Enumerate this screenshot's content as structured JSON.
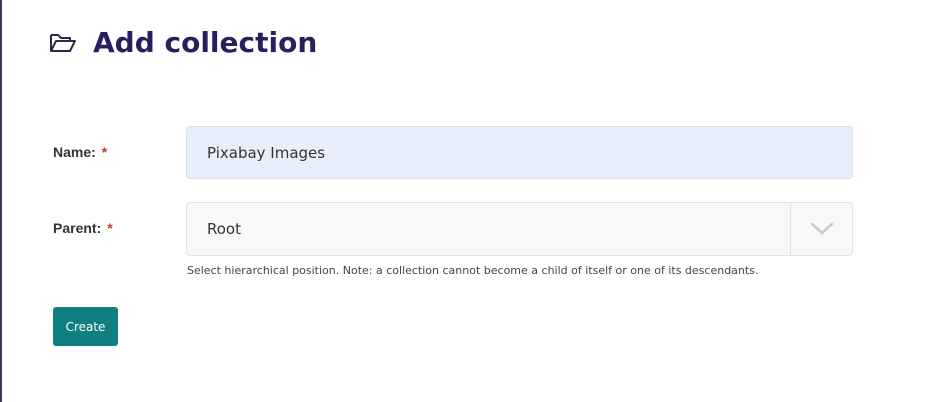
{
  "header": {
    "icon": "folder-open-icon",
    "title": "Add collection"
  },
  "form": {
    "name": {
      "label": "Name:",
      "required_mark": "*",
      "value": "Pixabay Images"
    },
    "parent": {
      "label": "Parent:",
      "required_mark": "*",
      "selected": "Root",
      "arrow_icon": "chevron-down-icon",
      "help": "Select hierarchical position. Note: a collection cannot become a child of itself or one of its descendants."
    },
    "submit_label": "Create"
  },
  "colors": {
    "title": "#2a1f5e",
    "button": "#0f7f7f",
    "required": "#c0392b",
    "input_fill": "#e8effb"
  }
}
